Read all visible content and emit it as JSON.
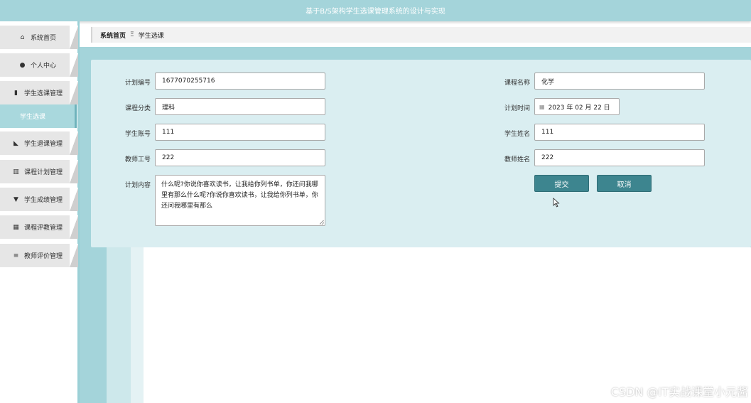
{
  "header": {
    "title": "基于B/S架构学生选课管理系统的设计与实现"
  },
  "sidebar": {
    "items": [
      {
        "label": "系统首页",
        "icon": "home-icon"
      },
      {
        "label": "个人中心",
        "icon": "user-icon"
      },
      {
        "label": "学生选课管理",
        "icon": "books-icon"
      },
      {
        "label": "学生退课管理",
        "icon": "thumb-icon"
      },
      {
        "label": "课程计划管理",
        "icon": "bar-chart-icon"
      },
      {
        "label": "学生成绩管理",
        "icon": "trophy-icon"
      },
      {
        "label": "课程评教管理",
        "icon": "grid-icon"
      },
      {
        "label": "教师评价管理",
        "icon": "list-icon"
      }
    ],
    "active_sub": "学生选课"
  },
  "breadcrumb": {
    "home": "系统首页",
    "separator": "Ξ",
    "current": "学生选课"
  },
  "form": {
    "plan_no": {
      "label": "计划编号",
      "value": "1677070255716"
    },
    "course_name": {
      "label": "课程名称",
      "value": "化学"
    },
    "course_category": {
      "label": "课程分类",
      "value": "理科"
    },
    "plan_time": {
      "label": "计划时间",
      "value": "2023 年 02 月 22 日"
    },
    "student_account": {
      "label": "学生账号",
      "value": "111"
    },
    "student_name": {
      "label": "学生姓名",
      "value": "111"
    },
    "teacher_no": {
      "label": "教师工号",
      "value": "222"
    },
    "teacher_name": {
      "label": "教师姓名",
      "value": "222"
    },
    "plan_content": {
      "label": "计划内容",
      "value": "什么呢?你说你喜欢读书，让我给你列书单，你还问我哪里有那么什么呢?你说你喜欢读书，让我给你列书单，你还问我哪里有那么"
    }
  },
  "buttons": {
    "submit": "提交",
    "cancel": "取消"
  },
  "watermark": "CSDN @IT实战课堂小元酱",
  "colors": {
    "accent": "#a4d4da",
    "panel": "#daeef1",
    "button": "#3d858f"
  }
}
